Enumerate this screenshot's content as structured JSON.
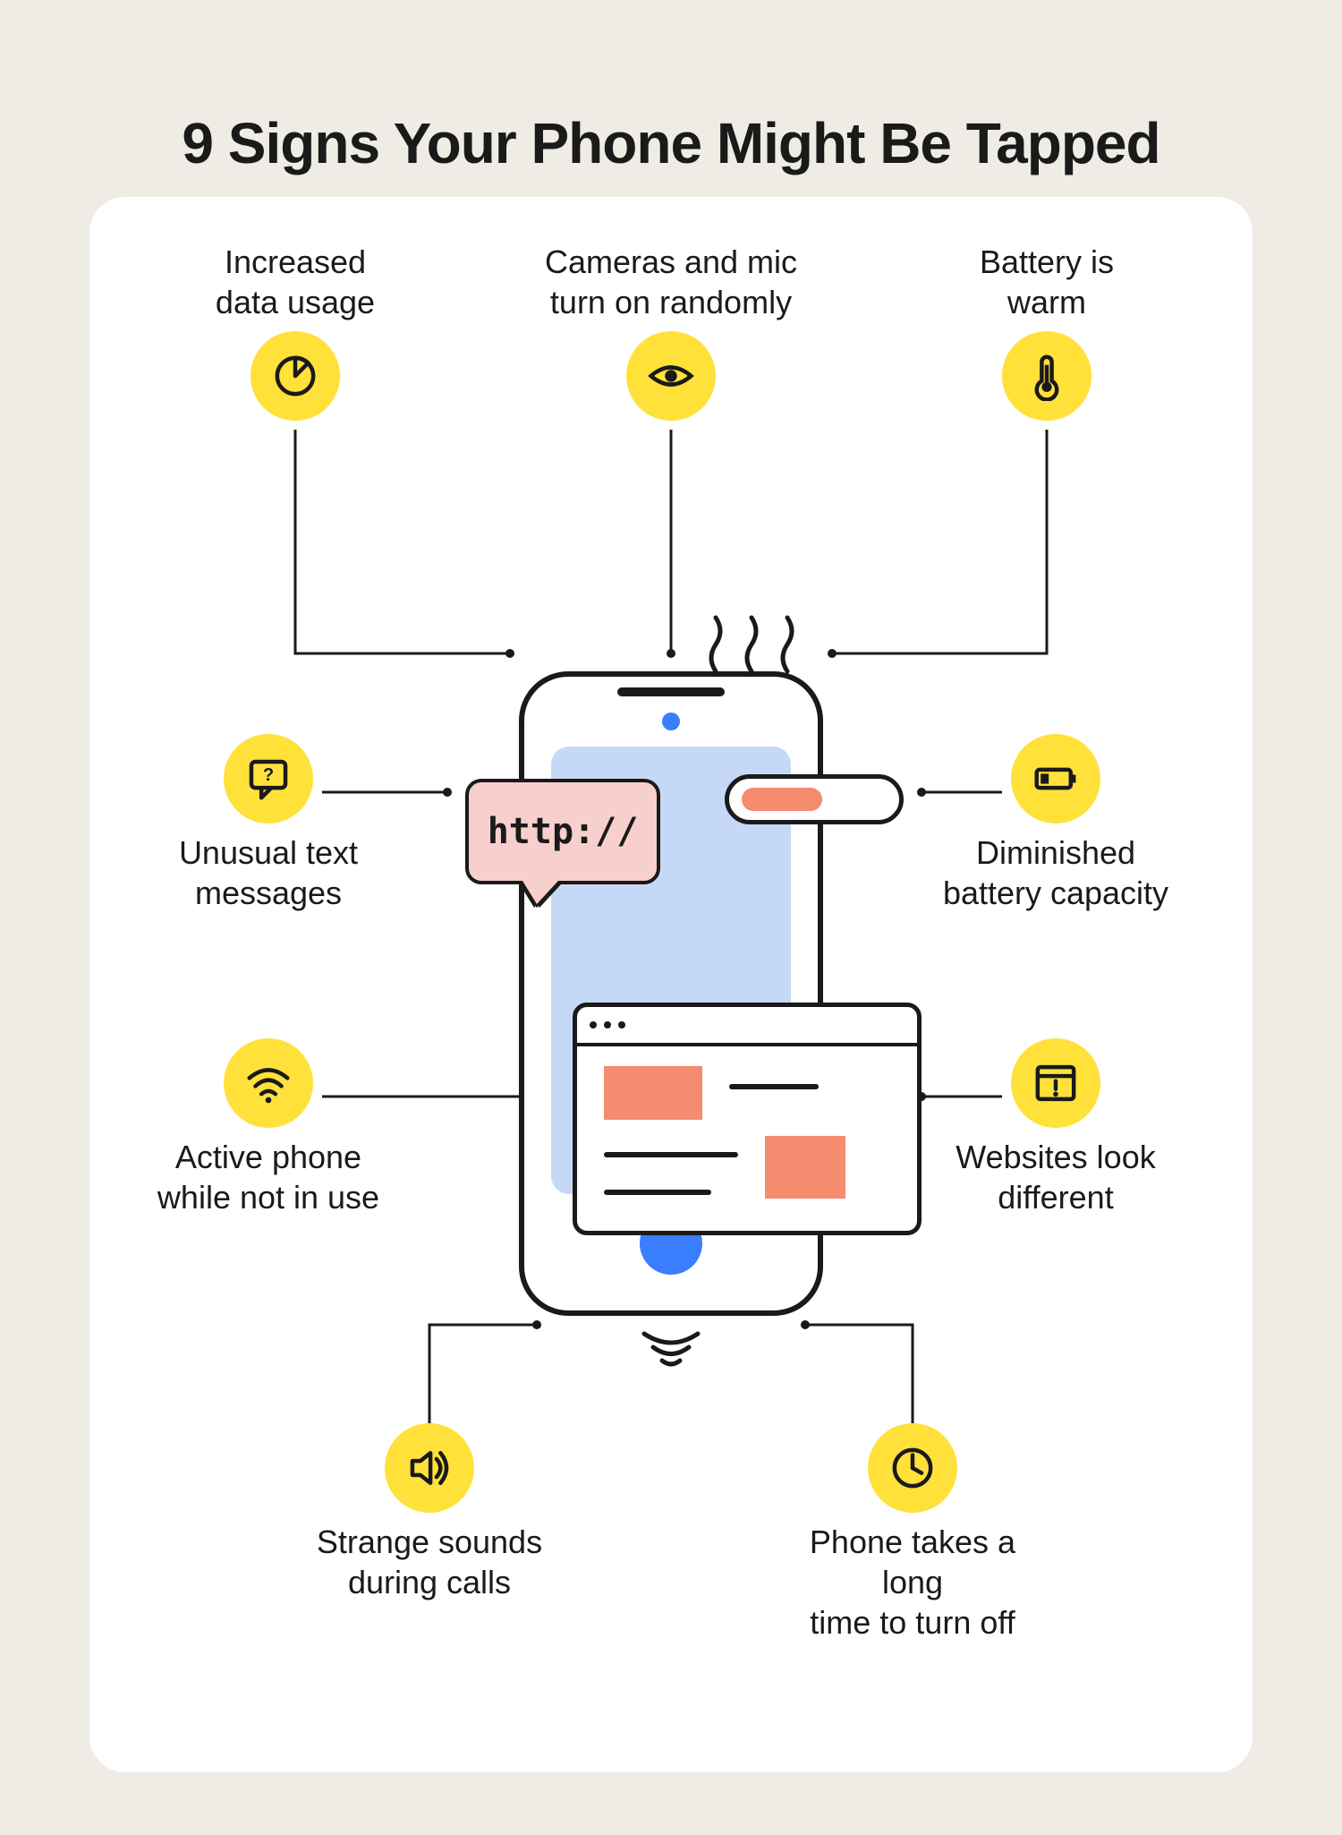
{
  "title": "9 Signs Your Phone Might Be Tapped",
  "bubble_text": "http://",
  "signs": {
    "data_usage": {
      "label": "Increased\ndata usage",
      "icon": "pie"
    },
    "camera_mic": {
      "label": "Cameras and mic\nturn on randomly",
      "icon": "eye"
    },
    "battery_warm": {
      "label": "Battery is\nwarm",
      "icon": "thermometer"
    },
    "unusual_text": {
      "label": "Unusual text\nmessages",
      "icon": "chat-question"
    },
    "battery_cap": {
      "label": "Diminished\nbattery capacity",
      "icon": "battery-low"
    },
    "active_idle": {
      "label": "Active phone\nwhile not in use",
      "icon": "wifi"
    },
    "websites": {
      "label": "Websites look\ndifferent",
      "icon": "window-alert"
    },
    "strange_sounds": {
      "label": "Strange sounds\nduring calls",
      "icon": "speaker"
    },
    "long_off": {
      "label": "Phone takes a long\ntime to turn off",
      "icon": "clock"
    }
  },
  "colors": {
    "bg": "#efece6",
    "card": "#ffffff",
    "yellow": "#ffe13a",
    "blue": "#3a7eff",
    "lightblue": "#c5d9f7",
    "salmon": "#f58b6f",
    "pink": "#f7cfcc",
    "ink": "#1a1a1a"
  }
}
